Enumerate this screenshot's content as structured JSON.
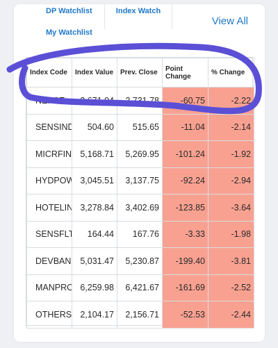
{
  "tabs": {
    "dp_watchlist": "DP Watchlist",
    "index_watch": "Index Watch",
    "my_watchlist": "My Watchlist"
  },
  "view_all": "View All",
  "table": {
    "headers": [
      "Index Code",
      "Index Value",
      "Prev. Close",
      "Point Change",
      "% Change"
    ],
    "rows": [
      {
        "code": "NEPSE",
        "value": "2,671.04",
        "prev": "2,731.78",
        "point": "-60.75",
        "pct": "-2.22"
      },
      {
        "code": "SENSIND",
        "value": "504.60",
        "prev": "515.65",
        "point": "-11.04",
        "pct": "-2.14"
      },
      {
        "code": "MICRFININD",
        "value": "5,168.71",
        "prev": "5,269.95",
        "point": "-101.24",
        "pct": "-1.92"
      },
      {
        "code": "HYDPOWIND",
        "value": "3,045.51",
        "prev": "3,137.75",
        "point": "-92.24",
        "pct": "-2.94"
      },
      {
        "code": "HOTELIND",
        "value": "3,278.84",
        "prev": "3,402.69",
        "point": "-123.85",
        "pct": "-3.64"
      },
      {
        "code": "SENSFLTIND",
        "value": "164.44",
        "prev": "167.76",
        "point": "-3.33",
        "pct": "-1.98"
      },
      {
        "code": "DEVBANKIND",
        "value": "5,031.47",
        "prev": "5,230.87",
        "point": "-199.40",
        "pct": "-3.81"
      },
      {
        "code": "MANPROCIND",
        "value": "6,259.98",
        "prev": "6,421.67",
        "point": "-161.69",
        "pct": "-2.52"
      },
      {
        "code": "OTHERSIND",
        "value": "2,104.17",
        "prev": "2,156.71",
        "point": "-52.53",
        "pct": "-2.44"
      }
    ]
  },
  "colors": {
    "negative_bg": "#f9a191",
    "link": "#1f78c8",
    "annotation": "#5b4fd6"
  }
}
